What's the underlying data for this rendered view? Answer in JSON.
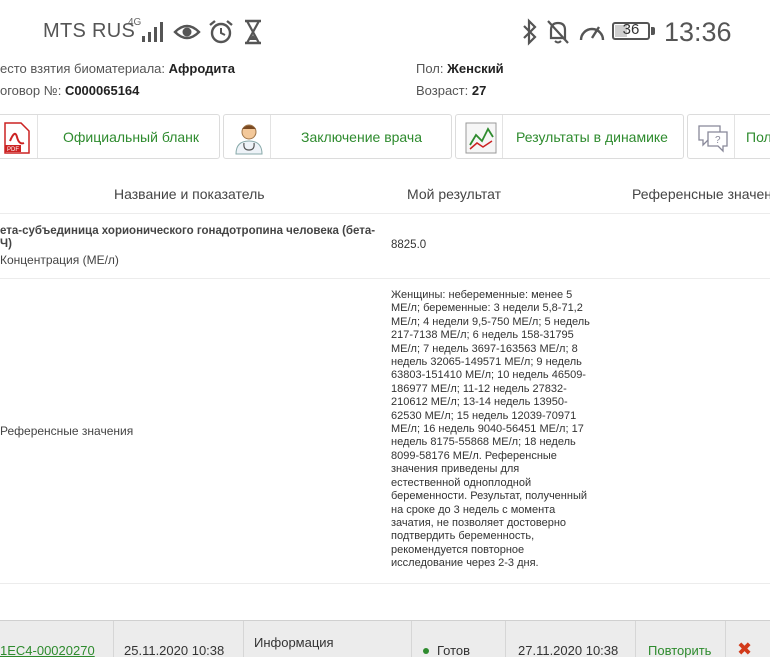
{
  "status_bar": {
    "carrier": "MTS RUS",
    "network": "4G",
    "battery": "36",
    "battery_level": 0.36,
    "time": "13:36",
    "icons": [
      "signal-icon",
      "eye-icon",
      "alarm-icon",
      "hourglass-icon",
      "bluetooth-icon",
      "bell-muted-icon",
      "speedometer-icon",
      "battery-icon"
    ]
  },
  "patient": {
    "sample_place_label": "есто взятия биоматериала:",
    "sample_place_value": "Афродита",
    "contract_label": "оговор №:",
    "contract_value": "С000065164",
    "sex_label": "Пол:",
    "sex_value": "Женский",
    "age_label": "Возраст:",
    "age_value": "27"
  },
  "actions": {
    "official_form": "Официальный бланк",
    "doctor_conclusion": "Заключение врача",
    "dynamics": "Результаты в динамике",
    "more": "Пол"
  },
  "table": {
    "headers": {
      "name": "Название и показатель",
      "result": "Мой результат",
      "reference": "Референсные значени"
    },
    "test_name_line1": "ета-субъединица хорионического гонадотропина человека (бета-",
    "test_name_line2": "Ч)",
    "unit": "Концентрация (МЕ/л)",
    "result_value": "8825.0",
    "reference_label": "Референсные значения",
    "reference_text_lines": [
      "Женщины: небеременные: менее 5",
      "МЕ/л; беременные: 3 недели 5,8-71,2",
      "МЕ/л; 4 недели 9,5-750 МЕ/л; 5 недель",
      "217-7138 МЕ/л; 6 недель 158-31795",
      "МЕ/л; 7 недель 3697-163563 МЕ/л; 8",
      "недель 32065-149571 МЕ/л; 9 недель",
      "63803-151410 МЕ/л; 10 недель 46509-",
      "186977 МЕ/л; 11-12 недель 27832-",
      "210612 МЕ/л; 13-14 недель 13950-",
      "62530 МЕ/л; 15 недель 12039-70971",
      "МЕ/л; 16 недель 9040-56451 МЕ/л; 17",
      "недель 8175-55868 МЕ/л; 18 недель",
      "8099-58176 МЕ/л. Референсные",
      "значения приведены для",
      "естественной одноплодной",
      "беременности. Результат, полученный",
      "на сроке до 3 недель с момента",
      "зачатия, не позволяет достоверно",
      "подтвердить беременность,",
      "рекомендуется повторное",
      "исследование через 2-3 дня."
    ]
  },
  "order": {
    "id": "1EC4-00020270",
    "created": "25.11.2020 10:38",
    "info": "Информация",
    "status": "Готов",
    "completed": "27.11.2020 10:38",
    "repeat": "Повторить",
    "delete": "✖",
    "colors": {
      "id": "#2e8b2e",
      "status_dot": "#2e8b2e",
      "repeat": "#2e8b2e",
      "delete": "#d23a1a"
    }
  }
}
